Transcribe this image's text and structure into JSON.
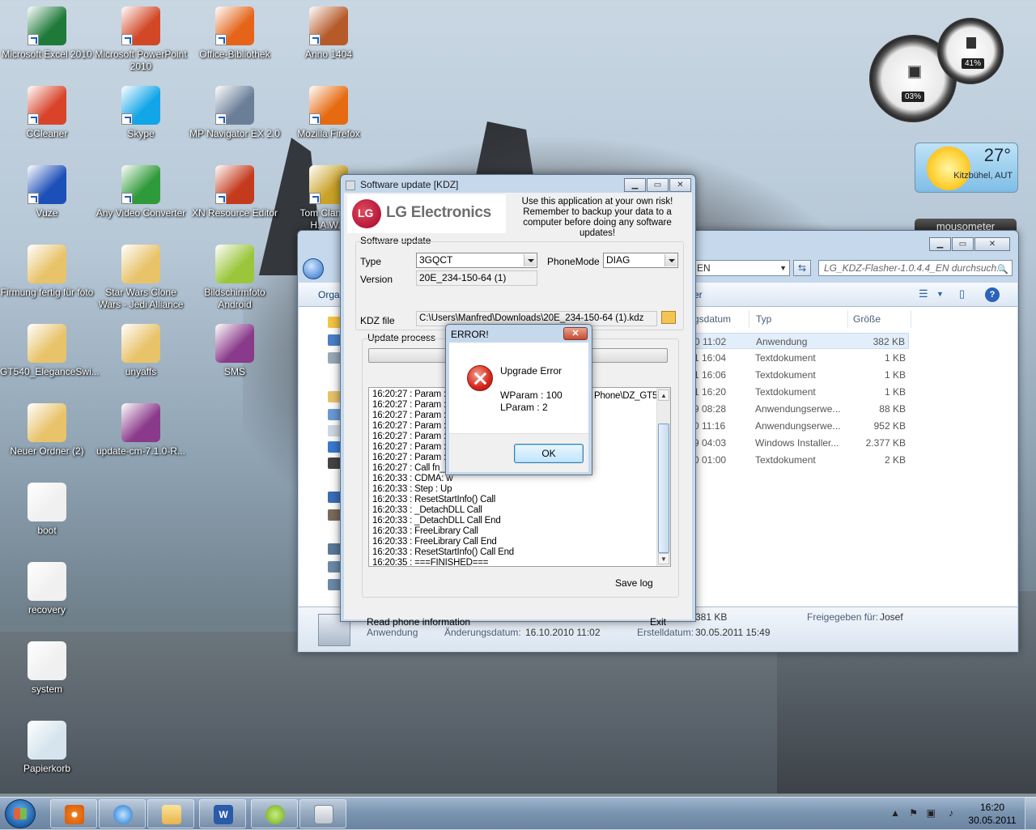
{
  "desktop": {
    "icons": [
      {
        "label": "Microsoft Excel 2010",
        "icon": "excel-icon",
        "color": "#1f7a3a"
      },
      {
        "label": "Microsoft PowerPoint 2010",
        "icon": "powerpoint-icon",
        "color": "#d24726"
      },
      {
        "label": "Office-Bibliothek",
        "icon": "office-library-icon",
        "color": "#e5641a"
      },
      {
        "label": "Anno 1404",
        "icon": "anno-icon",
        "color": "#b65a2a"
      },
      {
        "label": "CCleaner",
        "icon": "ccleaner-icon",
        "color": "#d8432a"
      },
      {
        "label": "Skype",
        "icon": "skype-icon",
        "color": "#12a5e8"
      },
      {
        "label": "MP Navigator EX 2.0",
        "icon": "mp-navigator-icon",
        "color": "#6a7e98"
      },
      {
        "label": "Mozilla Firefox",
        "icon": "firefox-icon",
        "color": "#e66a10"
      },
      {
        "label": "Vuze",
        "icon": "vuze-icon",
        "color": "#1d4fb8"
      },
      {
        "label": "Any Video Converter",
        "icon": "video-converter-icon",
        "color": "#2f9a3a"
      },
      {
        "label": "XN Resource Editor",
        "icon": "resource-editor-icon",
        "color": "#c43a1c"
      },
      {
        "label": "Tom Clancy's H.A.W.X",
        "icon": "hawx-icon",
        "color": "#c9a227"
      },
      {
        "label": "Firmung fertig für foto",
        "icon": "folder-icon",
        "color": "#e8c36a"
      },
      {
        "label": "Star Wars Clone Wars - Jedi Alliance",
        "icon": "folder-icon",
        "color": "#e8c36a"
      },
      {
        "label": "Bildschirmfoto Android",
        "icon": "android-icon",
        "color": "#9bc63c"
      },
      {
        "label": "GT540_EleganceSwi...",
        "icon": "folder-icon",
        "color": "#e8c36a"
      },
      {
        "label": "unyaffs",
        "icon": "folder-icon",
        "color": "#e8c36a"
      },
      {
        "label": "SMS",
        "icon": "winrar-icon",
        "color": "#8a3a8a"
      },
      {
        "label": "Neuer Ordner (2)",
        "icon": "folder-icon",
        "color": "#e8c36a"
      },
      {
        "label": "update-cm-7.1.0-R...",
        "icon": "winrar-icon",
        "color": "#8a3a8a"
      },
      {
        "label": "boot",
        "icon": "image-file-icon",
        "color": "#f0f0f0"
      },
      {
        "label": "recovery",
        "icon": "image-file-icon",
        "color": "#f0f0f0"
      },
      {
        "label": "system",
        "icon": "image-file-icon",
        "color": "#f0f0f0"
      },
      {
        "label": "Papierkorb",
        "icon": "recycle-bin-icon",
        "color": "#d6e4ee"
      }
    ]
  },
  "gadgets": {
    "cpu_percent": "03%",
    "mem_percent": "41%",
    "weather_temp": "27°",
    "weather_city": "Kitzbühel, AUT",
    "mousometer": "mousometer"
  },
  "explorer": {
    "address_fragment": "EN",
    "search_placeholder": "LG_KDZ-Flasher-1.0.4.4_EN durchsuch...",
    "toolbar_org": "Orga",
    "toolbar_right": "er",
    "columns": {
      "date": "gsdatum",
      "type": "Typ",
      "size": "Größe"
    },
    "files": [
      {
        "date": "0 11:02",
        "type": "Anwendung",
        "size": "382 KB"
      },
      {
        "date": "1 16:04",
        "type": "Textdokument",
        "size": "1 KB"
      },
      {
        "date": "1 16:06",
        "type": "Textdokument",
        "size": "1 KB"
      },
      {
        "date": "1 16:20",
        "type": "Textdokument",
        "size": "1 KB"
      },
      {
        "date": "9 08:28",
        "type": "Anwendungserwe...",
        "size": "88 KB"
      },
      {
        "date": "0 11:16",
        "type": "Anwendungserwe...",
        "size": "952 KB"
      },
      {
        "date": "9 04:03",
        "type": "Windows Installer...",
        "size": "2.377 KB"
      },
      {
        "date": "0 01:00",
        "type": "Textdokument",
        "size": "2 KB"
      }
    ],
    "status": {
      "size": "381 KB",
      "shared_label": "Freigegeben für:",
      "shared_value": "Josef",
      "type": "Anwendung",
      "modified_label": "Änderungsdatum:",
      "modified_value": "16.10.2010 11:02",
      "created_label": "Erstelldatum:",
      "created_value": "30.05.2011 15:49"
    }
  },
  "kdz": {
    "title": "Software update [KDZ]",
    "logo_text": "LG Electronics",
    "warning": "Use this application at your own risk! Remember to backup your data to a computer before doing any software updates!",
    "section_label": "Software update",
    "type_label": "Type",
    "type_value": "3GQCT",
    "phonemode_label": "PhoneMode",
    "phonemode_value": "DIAG",
    "version_label": "Version",
    "version_value": "20E_234-150-64 (1)",
    "kdz_label": "KDZ file",
    "kdz_value": "C:\\Users\\Manfred\\Downloads\\20E_234-150-64 (1).kdz",
    "update_label": "Update process",
    "log": [
      "16:20:27 : Param : F",
      "16:20:27 : Param : n",
      "16:20:27 : Param : w",
      "16:20:27 : Param : U",
      "16:20:27 : Param : P",
      "16:20:27 : Param : B",
      "16:20:27 : Param : A",
      "16:20:27 : Call fn_St",
      "16:20:33 : CDMA: w",
      "16:20:33 : Step : Up",
      "16:20:33 : ResetStartInfo() Call",
      "16:20:33 : _DetachDLL Call",
      "16:20:33 : _DetachDLL Call End",
      "16:20:33 : FreeLibrary Call",
      "16:20:33 : FreeLibrary Call End",
      "16:20:33 : ResetStartInfo() Call End",
      "16:20:35 : ===FINISHED==="
    ],
    "log_tail": "Phone\\DZ_GT5",
    "save_log": "Save log",
    "read_phone": "Read phone information",
    "exit": "Exit"
  },
  "error": {
    "title": "ERROR!",
    "message": "Upgrade Error",
    "wparam": "WParam : 100",
    "lparam": "LParam : 2",
    "ok": "OK"
  },
  "taskbar": {
    "time": "16:20",
    "date": "30.05.2011"
  }
}
